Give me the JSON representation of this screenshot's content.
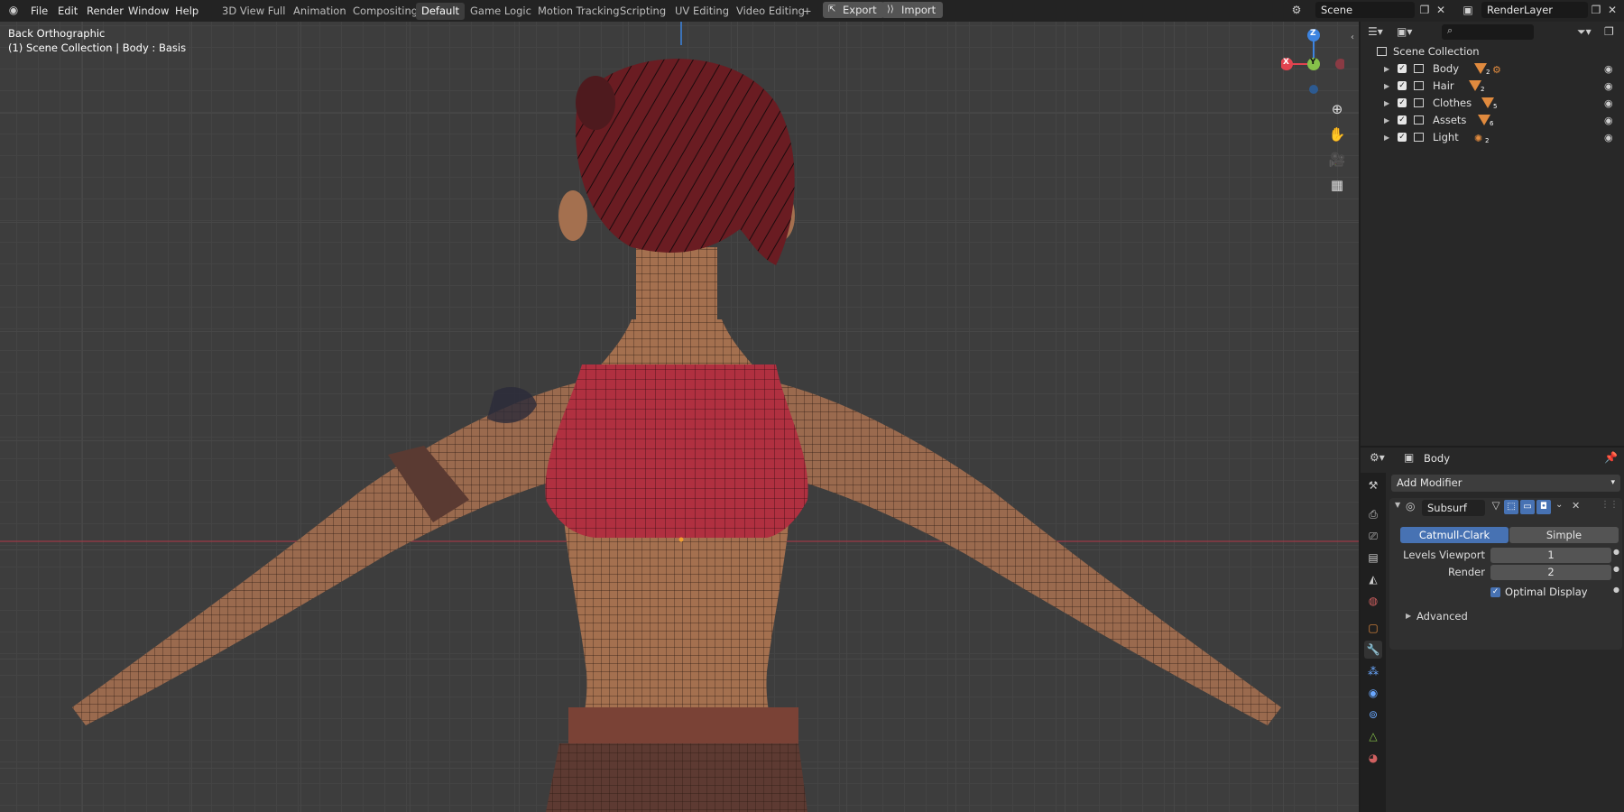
{
  "menu": [
    "File",
    "Edit",
    "Render",
    "Window",
    "Help"
  ],
  "workspaces": [
    "3D View Full",
    "Animation",
    "Compositing",
    "Default",
    "Game Logic",
    "Motion Tracking",
    "Scripting",
    "UV Editing",
    "Video Editing"
  ],
  "active_workspace": "Default",
  "add_tab": "+",
  "export_label": "Export",
  "import_label": "Import",
  "scene_name": "Scene",
  "view_layer": "RenderLayer",
  "viewport": {
    "view_name": "Back Orthographic",
    "context": "(1) Scene Collection | Body : Basis",
    "gizmo": {
      "z": "Z",
      "y": "Y",
      "x": "X"
    }
  },
  "outliner": {
    "search_placeholder": "",
    "root": "Scene Collection",
    "collections": [
      {
        "name": "Body",
        "count": "2"
      },
      {
        "name": "Hair",
        "count": "2"
      },
      {
        "name": "Clothes",
        "count": "5"
      },
      {
        "name": "Assets",
        "count": "6"
      },
      {
        "name": "Light",
        "count": "2"
      }
    ]
  },
  "properties": {
    "object_name": "Body",
    "add_modifier": "Add Modifier",
    "modifier": {
      "name": "Subsurf",
      "mode_catmull": "Catmull-Clark",
      "mode_simple": "Simple",
      "levels_viewport_label": "Levels Viewport",
      "levels_viewport_value": "1",
      "render_label": "Render",
      "render_value": "2",
      "optimal_display": "Optimal Display",
      "advanced": "Advanced"
    }
  },
  "colors": {
    "accent": "#4772b3",
    "axis_x": "#e2434f",
    "axis_y": "#86c14a",
    "axis_z": "#3d84e0",
    "collection_icon": "#e08a3e"
  }
}
